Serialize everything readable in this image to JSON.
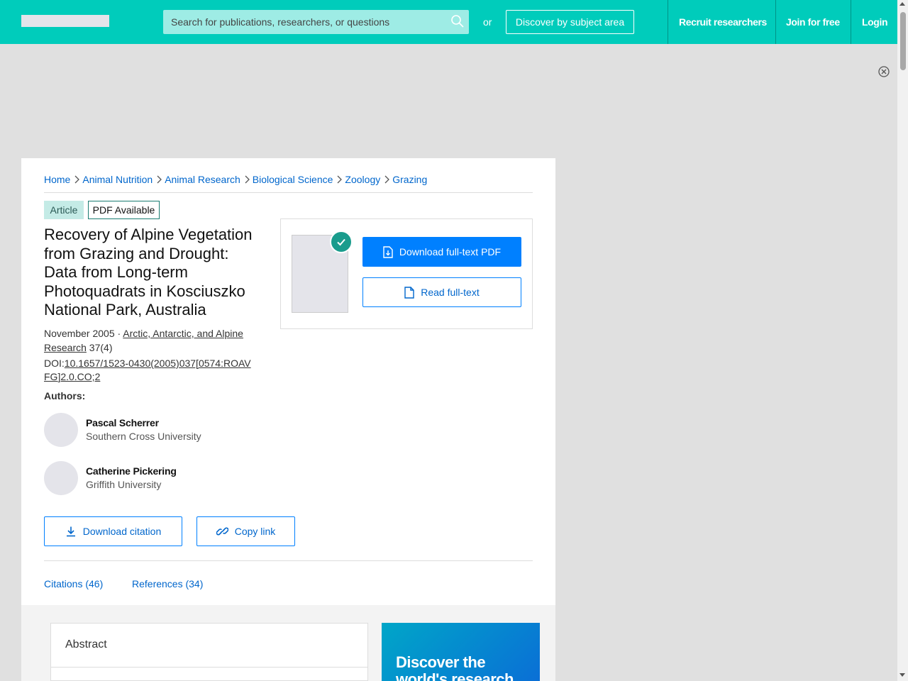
{
  "header": {
    "search_placeholder": "Search for publications, researchers, or questions",
    "or_text": "or",
    "discover_label": "Discover by subject area",
    "nav": [
      "Recruit researchers",
      "Join for free",
      "Login"
    ]
  },
  "breadcrumb": [
    "Home",
    "Animal Nutrition",
    "Animal Research",
    "Biological Science",
    "Zoology",
    "Grazing"
  ],
  "badges": {
    "type": "Article",
    "pdf": "PDF Available"
  },
  "article": {
    "title": "Recovery of Alpine Vegetation from Grazing and Drought: Data from Long-term Photoquadrats in Kosciuszko National Park, Australia",
    "date": "November 2005",
    "separator": " · ",
    "journal": "Arctic, Antarctic, and Alpine Research",
    "volume": " 37(4)",
    "doi_label": "DOI:",
    "doi": "10.1657/1523-0430(2005)037[0574:ROAVFG]2.0.CO;2"
  },
  "authors_label": "Authors:",
  "authors": [
    {
      "name": "Pascal Scherrer",
      "institution": "Southern Cross University"
    },
    {
      "name": "Catherine Pickering",
      "institution": "Griffith University"
    }
  ],
  "actions": {
    "download_pdf": "Download full-text PDF",
    "read_fulltext": "Read full-text",
    "download_citation": "Download citation",
    "copy_link": "Copy link"
  },
  "tabs": [
    "Citations (46)",
    "References (34)"
  ],
  "abstract_title": "Abstract",
  "promo_text": "Discover the world's research",
  "colors": {
    "brand": "#00ccbb",
    "link": "#0066cc",
    "primary_button": "#0080ff",
    "check_badge": "#1a9c8d"
  },
  "icons": [
    "search-icon",
    "chevron-right-icon",
    "check-icon",
    "file-download-icon",
    "file-icon",
    "download-icon",
    "link-icon",
    "close-circle-icon"
  ]
}
